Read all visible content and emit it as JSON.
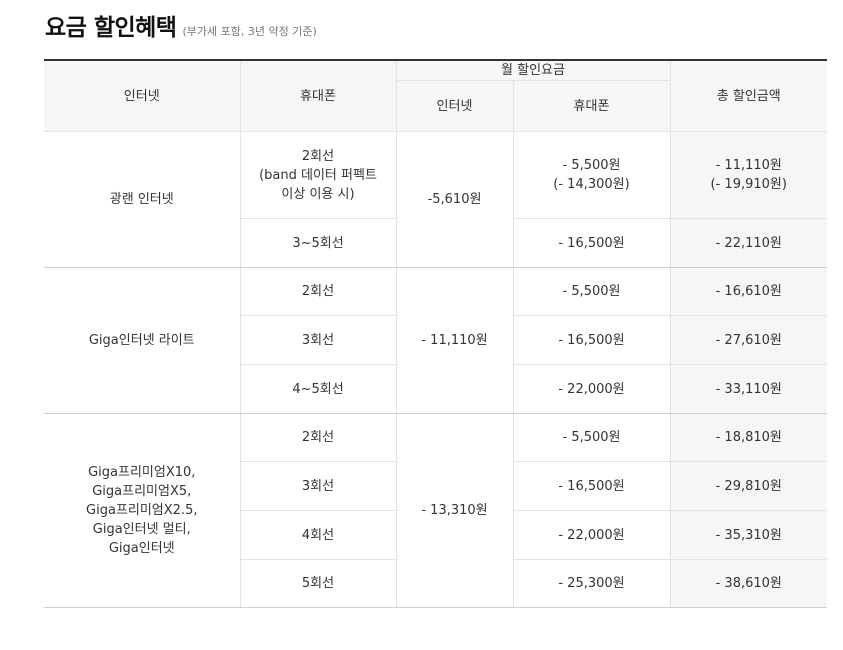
{
  "header": {
    "title": "요금 할인혜택",
    "subtitle": "(부가세 포함, 3년 약정 기준)"
  },
  "table": {
    "headers": {
      "internet": "인터넷",
      "mobile": "휴대폰",
      "monthly_discount": "월 할인요금",
      "monthly_internet": "인터넷",
      "monthly_mobile": "휴대폰",
      "total_discount": "총 할인금액"
    },
    "groups": [
      {
        "internet": "광랜 인터넷",
        "internet_discount": "-5,610원",
        "rows": [
          {
            "mobile": "2회선\n(band 데이터 퍼펙트\n이상 이용 시)",
            "mobile_discount": "- 5,500원\n(- 14,300원)",
            "total": "- 11,110원\n(- 19,910원)"
          },
          {
            "mobile": "3~5회선",
            "mobile_discount": "- 16,500원",
            "total": "- 22,110원"
          }
        ]
      },
      {
        "internet": "Giga인터넷 라이트",
        "internet_discount": "- 11,110원",
        "rows": [
          {
            "mobile": "2회선",
            "mobile_discount": "- 5,500원",
            "total": "- 16,610원"
          },
          {
            "mobile": "3회선",
            "mobile_discount": "- 16,500원",
            "total": "- 27,610원"
          },
          {
            "mobile": "4~5회선",
            "mobile_discount": "- 22,000원",
            "total": "- 33,110원"
          }
        ]
      },
      {
        "internet": "Giga프리미엄X10,\nGiga프리미엄X5,\nGiga프리미엄X2.5,\nGiga인터넷 멀티,\nGiga인터넷",
        "internet_discount": "- 13,310원",
        "rows": [
          {
            "mobile": "2회선",
            "mobile_discount": "- 5,500원",
            "total": "- 18,810원"
          },
          {
            "mobile": "3회선",
            "mobile_discount": "- 16,500원",
            "total": "- 29,810원"
          },
          {
            "mobile": "4회선",
            "mobile_discount": "- 22,000원",
            "total": "- 35,310원"
          },
          {
            "mobile": "5회선",
            "mobile_discount": "- 25,300원",
            "total": "- 38,610원"
          }
        ]
      }
    ]
  }
}
